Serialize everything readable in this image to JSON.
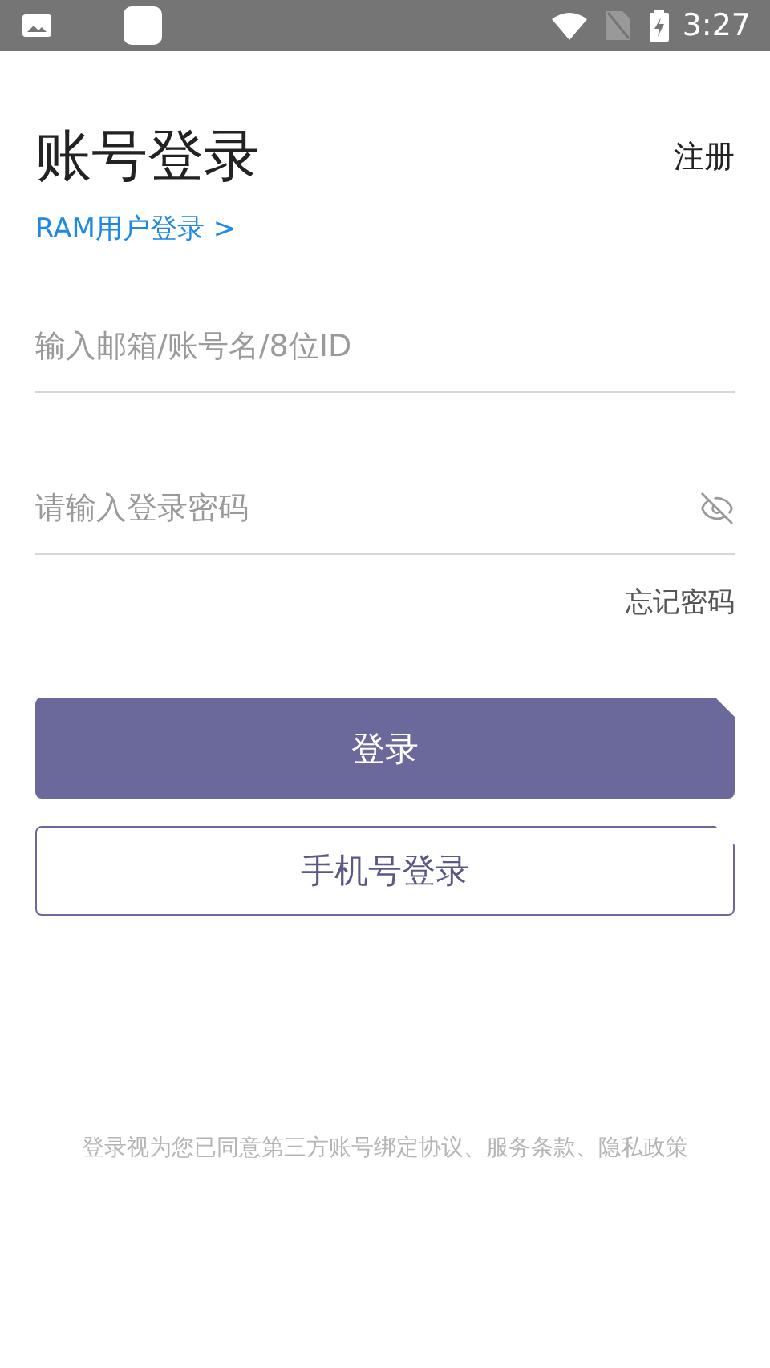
{
  "status_bar": {
    "time": "3:27"
  },
  "title": "账号登录",
  "register_link": "注册",
  "ram_link": "RAM用户登录 >",
  "account_field": {
    "placeholder": "输入邮箱/账号名/8位ID"
  },
  "password_field": {
    "placeholder": "请输入登录密码",
    "visible": false
  },
  "forgot_link": "忘记密码",
  "buttons": [
    {
      "label": "登录",
      "kind": "primary"
    },
    {
      "label": "手机号登录",
      "kind": "outline"
    }
  ],
  "terms": "登录视为您已同意第三方账号绑定协议、服务条款、隐私政策"
}
